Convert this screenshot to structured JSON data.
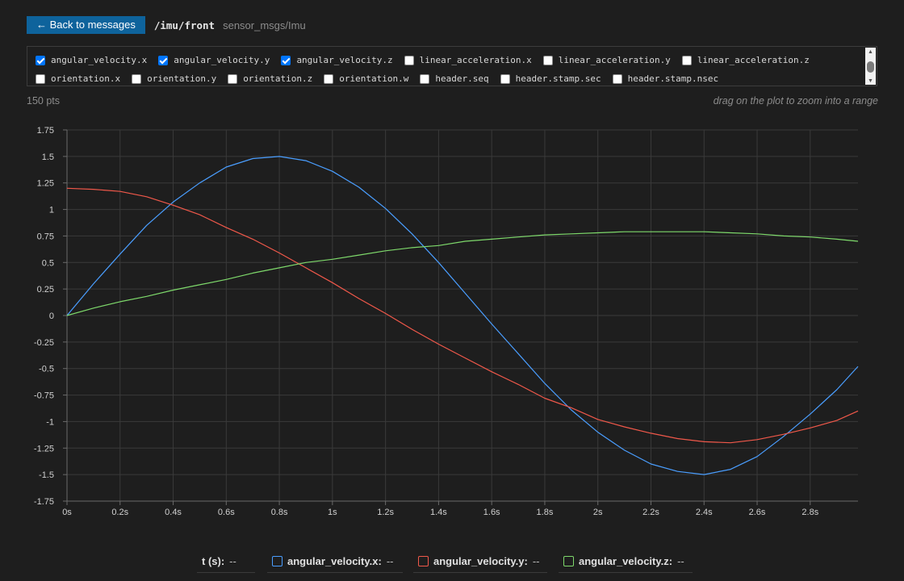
{
  "header": {
    "back_label": "← Back to messages",
    "topic": "/imu/front",
    "msg_type": "sensor_msgs/Imu"
  },
  "fields": [
    {
      "label": "angular_velocity.x",
      "checked": true
    },
    {
      "label": "angular_velocity.y",
      "checked": true
    },
    {
      "label": "angular_velocity.z",
      "checked": true
    },
    {
      "label": "linear_acceleration.x",
      "checked": false
    },
    {
      "label": "linear_acceleration.y",
      "checked": false
    },
    {
      "label": "linear_acceleration.z",
      "checked": false
    },
    {
      "label": "orientation.x",
      "checked": false
    },
    {
      "label": "orientation.y",
      "checked": false
    },
    {
      "label": "orientation.z",
      "checked": false
    },
    {
      "label": "orientation.w",
      "checked": false
    },
    {
      "label": "header.seq",
      "checked": false
    },
    {
      "label": "header.stamp.sec",
      "checked": false
    },
    {
      "label": "header.stamp.nsec",
      "checked": false
    }
  ],
  "info": {
    "points": "150 pts",
    "hint": "drag on the plot to zoom into a range"
  },
  "legend": {
    "time_label": "t (s):",
    "time_value": "--",
    "items": [
      {
        "name": "angular_velocity.x:",
        "value": "--",
        "color": "#4a9eff"
      },
      {
        "name": "angular_velocity.y:",
        "value": "--",
        "color": "#f0584a"
      },
      {
        "name": "angular_velocity.z:",
        "value": "--",
        "color": "#7ed96b"
      }
    ]
  },
  "colors": {
    "background": "#1e1e1e",
    "grid": "#3a3a3a",
    "accent": "#0e639c"
  },
  "chart_data": {
    "type": "line",
    "xlim": [
      0,
      2.98
    ],
    "ylim": [
      -1.75,
      1.75
    ],
    "x_ticks": [
      "0s",
      "0.2s",
      "0.4s",
      "0.6s",
      "0.8s",
      "1s",
      "1.2s",
      "1.4s",
      "1.6s",
      "1.8s",
      "2s",
      "2.2s",
      "2.4s",
      "2.6s",
      "2.8s"
    ],
    "y_ticks": [
      "1.75",
      "1.5",
      "1.25",
      "1",
      "0.75",
      "0.5",
      "0.25",
      "0",
      "-0.25",
      "-0.5",
      "-0.75",
      "-1",
      "-1.25",
      "-1.5",
      "-1.75"
    ],
    "x_tick_values": [
      0,
      0.2,
      0.4,
      0.6,
      0.8,
      1.0,
      1.2,
      1.4,
      1.6,
      1.8,
      2.0,
      2.2,
      2.4,
      2.6,
      2.8
    ],
    "y_tick_values": [
      1.75,
      1.5,
      1.25,
      1,
      0.75,
      0.5,
      0.25,
      0,
      -0.25,
      -0.5,
      -0.75,
      -1,
      -1.25,
      -1.5,
      -1.75
    ],
    "grid": true,
    "x": [
      0,
      0.1,
      0.2,
      0.3,
      0.4,
      0.5,
      0.6,
      0.7,
      0.8,
      0.9,
      1.0,
      1.1,
      1.2,
      1.3,
      1.4,
      1.5,
      1.6,
      1.7,
      1.8,
      1.9,
      2.0,
      2.1,
      2.2,
      2.3,
      2.4,
      2.5,
      2.6,
      2.7,
      2.8,
      2.9,
      2.98
    ],
    "series": [
      {
        "name": "angular_velocity.x",
        "color": "#4a9eff",
        "values": [
          0,
          0.3,
          0.58,
          0.85,
          1.07,
          1.25,
          1.4,
          1.48,
          1.5,
          1.46,
          1.36,
          1.21,
          1.01,
          0.77,
          0.5,
          0.21,
          -0.08,
          -0.36,
          -0.64,
          -0.89,
          -1.1,
          -1.27,
          -1.4,
          -1.47,
          -1.5,
          -1.45,
          -1.33,
          -1.14,
          -0.93,
          -0.7,
          -0.48
        ]
      },
      {
        "name": "angular_velocity.y",
        "color": "#f0584a",
        "values": [
          1.2,
          1.19,
          1.17,
          1.12,
          1.04,
          0.95,
          0.83,
          0.72,
          0.59,
          0.45,
          0.31,
          0.16,
          0.02,
          -0.13,
          -0.27,
          -0.4,
          -0.53,
          -0.65,
          -0.78,
          -0.87,
          -0.98,
          -1.05,
          -1.11,
          -1.16,
          -1.19,
          -1.2,
          -1.17,
          -1.12,
          -1.06,
          -0.99,
          -0.9
        ]
      },
      {
        "name": "angular_velocity.z",
        "color": "#7ed96b",
        "values": [
          0,
          0.07,
          0.13,
          0.18,
          0.24,
          0.29,
          0.34,
          0.4,
          0.45,
          0.5,
          0.53,
          0.57,
          0.61,
          0.64,
          0.66,
          0.7,
          0.72,
          0.74,
          0.76,
          0.77,
          0.78,
          0.79,
          0.79,
          0.79,
          0.79,
          0.78,
          0.77,
          0.75,
          0.74,
          0.72,
          0.7
        ]
      }
    ]
  }
}
